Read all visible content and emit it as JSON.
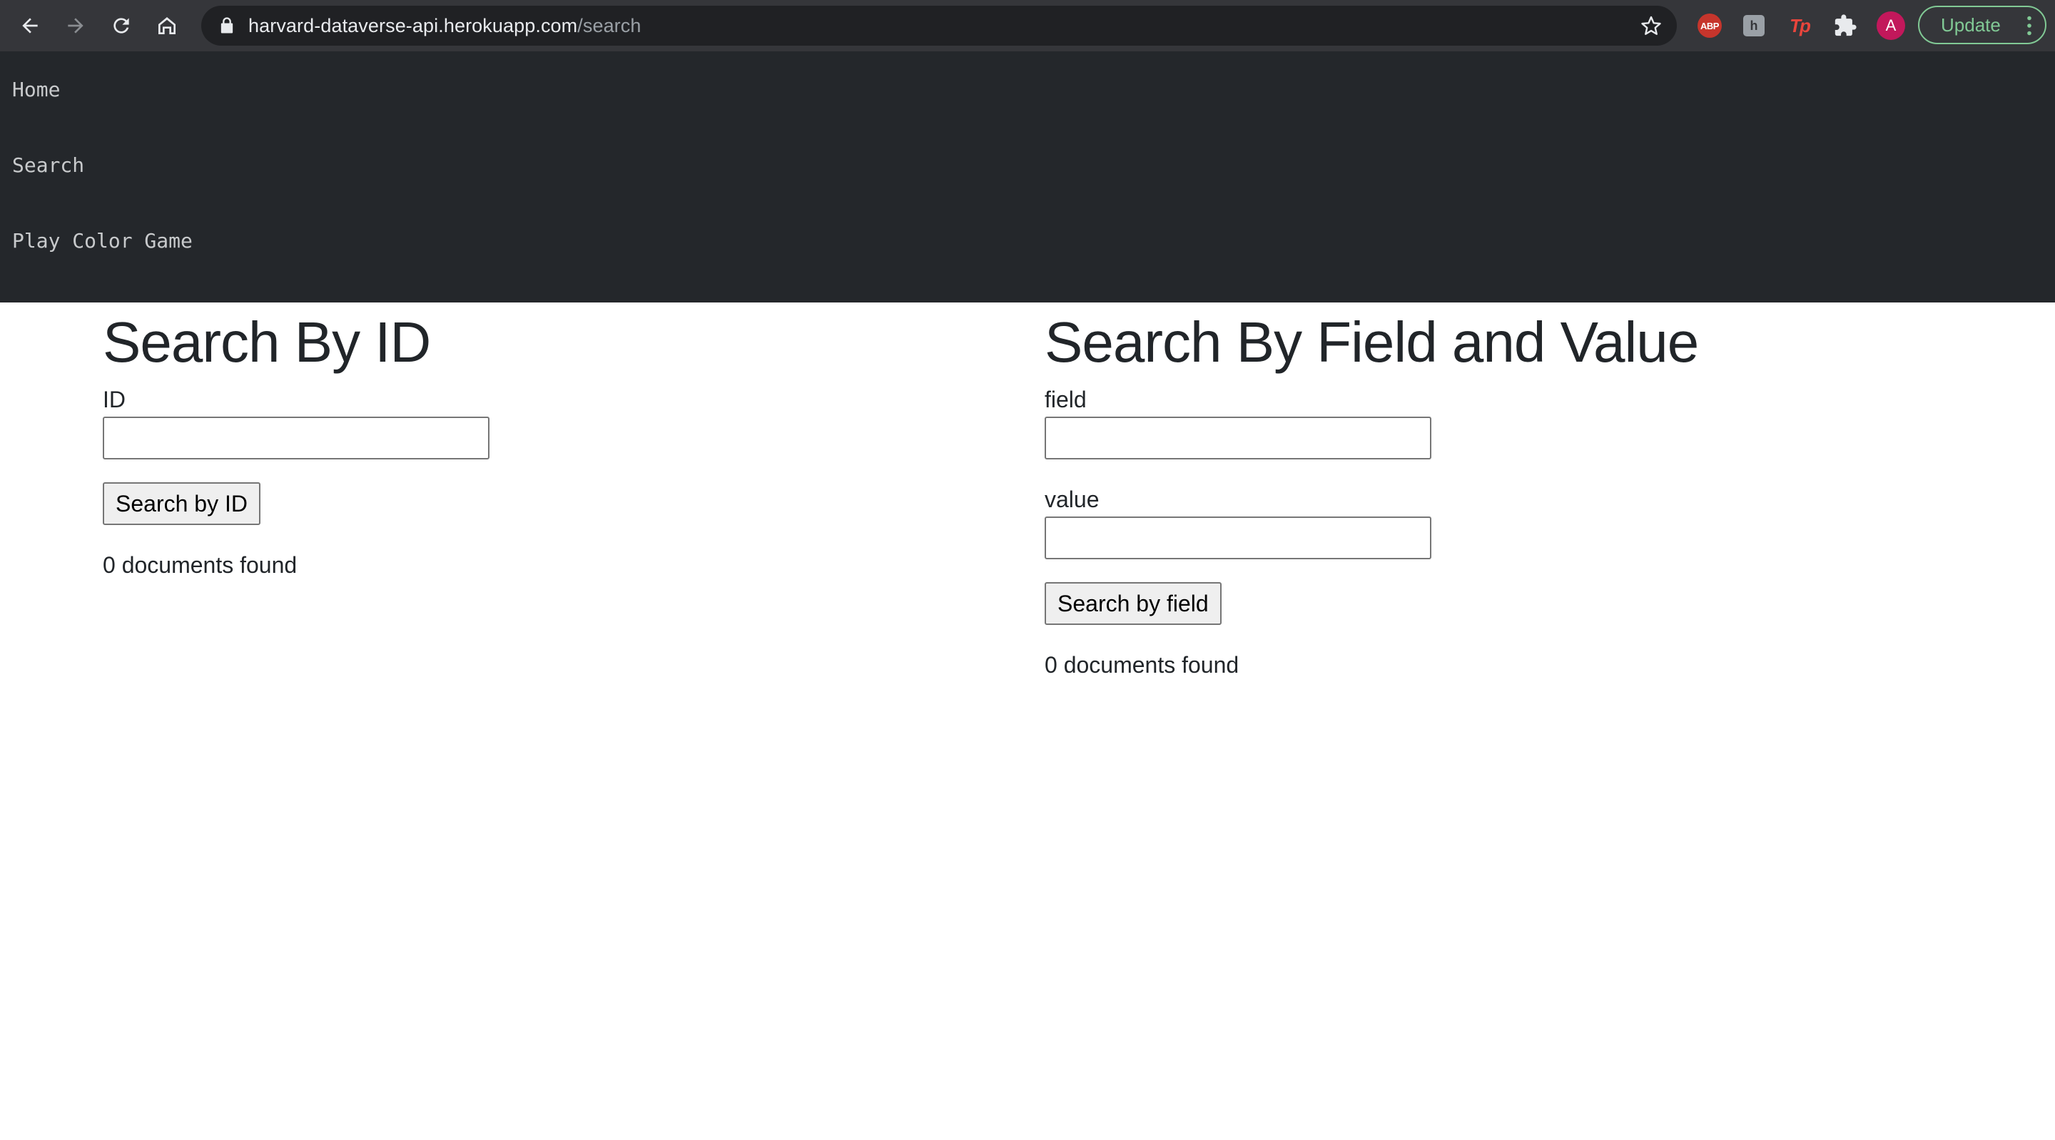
{
  "browser": {
    "url_host": "harvard-dataverse-api.herokuapp.com",
    "url_path": "/search",
    "update_label": "Update",
    "profile_initial": "A",
    "extensions": {
      "abp_label": "ABP",
      "gray_ext_label": "h",
      "tp_label": "Tp"
    },
    "icons": [
      "back-arrow-icon",
      "forward-arrow-icon",
      "reload-icon",
      "home-icon",
      "lock-icon",
      "star-icon",
      "puzzle-icon",
      "kebab-menu-icon"
    ]
  },
  "nav": {
    "items": [
      {
        "label": "Home"
      },
      {
        "label": "Search"
      },
      {
        "label": "Play Color Game"
      }
    ]
  },
  "search_by_id": {
    "title": "Search By ID",
    "id_label": "ID",
    "id_value": "",
    "button_label": "Search by ID",
    "result_text": "0 documents found"
  },
  "search_by_field": {
    "title": "Search By Field and Value",
    "field_label": "field",
    "field_value": "",
    "value_label": "value",
    "value_value": "",
    "button_label": "Search by field",
    "result_text": "0 documents found"
  },
  "colors": {
    "chrome_bg": "#35363a",
    "omnibox_bg": "#202124",
    "nav_bg": "#24272b",
    "update_accent": "#81c995",
    "avatar": "#c2185b"
  }
}
